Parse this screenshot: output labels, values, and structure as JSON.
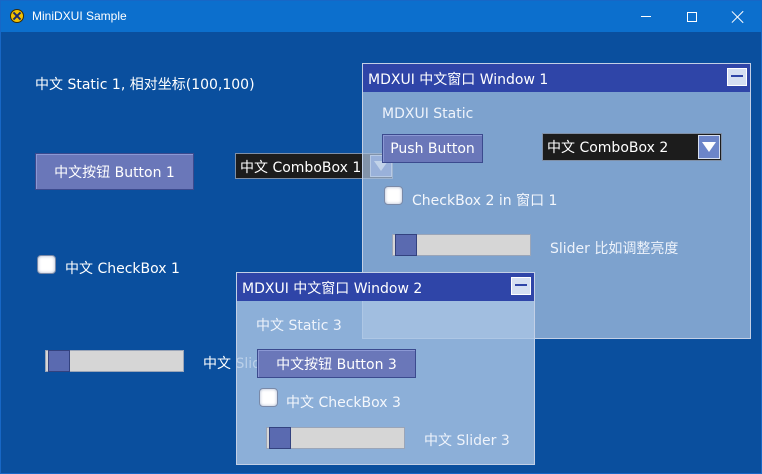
{
  "window": {
    "title": "MiniDXUI Sample"
  },
  "main": {
    "static1": "中文 Static 1, 相对坐标(100,100)",
    "button1": "中文按钮 Button 1",
    "combo1": {
      "selected": "中文 ComboBox 1"
    },
    "checkbox1": {
      "label": "中文 CheckBox 1",
      "checked": false
    },
    "slider1": {
      "label": "中文 Slider 1",
      "value_fraction": 0.08
    }
  },
  "window1": {
    "title": "MDXUI 中文窗口 Window 1",
    "static": "MDXUI Static",
    "push_button": "Push Button",
    "combo2": {
      "selected": "中文 ComboBox 2"
    },
    "checkbox2": {
      "label": "CheckBox 2 in 窗口 1",
      "checked": false
    },
    "slider2": {
      "label": "Slider 比如调整亮度",
      "value_fraction": 0.08
    }
  },
  "window2": {
    "title": "MDXUI 中文窗口 Window 2",
    "static3": "中文 Static 3",
    "button3": "中文按钮 Button 3",
    "checkbox3": {
      "label": "中文 CheckBox 3",
      "checked": false
    },
    "slider3": {
      "label": "中文 Slider 3",
      "value_fraction": 0.08
    }
  },
  "icons": {
    "app": "app-icon",
    "minimize": "minimize-icon",
    "maximize": "maximize-icon",
    "close": "close-icon",
    "dropdown": "chevron-down-icon"
  },
  "colors": {
    "background": "#0a4f9e",
    "titlebar": "#0c6fcd",
    "child_title": "#2f45a8",
    "button": "#6a77b9",
    "child_body": "#aac2e0"
  }
}
